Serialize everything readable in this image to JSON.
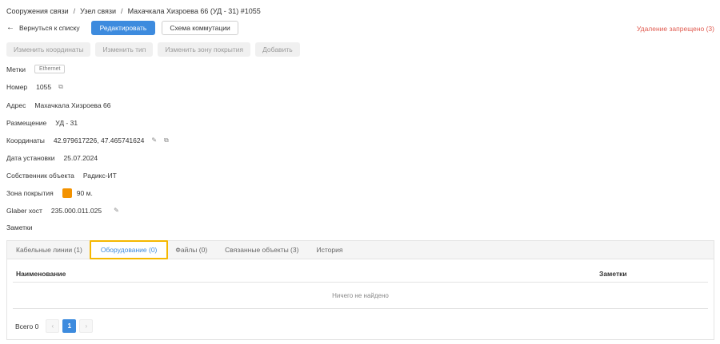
{
  "breadcrumb": [
    "Сооружения связи",
    "Узел связи",
    "Махачкала Хизроева 66 (УД - 31) #1055"
  ],
  "toolbar": {
    "back_label": "Вернуться к списку",
    "edit_label": "Редактировать",
    "scheme_label": "Схема коммутации",
    "delete_note": "Удаление запрещено (3)"
  },
  "actions": [
    "Изменить координаты",
    "Изменить тип",
    "Изменить зону покрытия",
    "Добавить"
  ],
  "fields": {
    "tags_label": "Метки",
    "tag": "Ethernet",
    "number_label": "Номер",
    "number": "1055",
    "address_label": "Адрес",
    "address": "Махачкала Хизроева 66",
    "placement_label": "Размещение",
    "placement": "УД - 31",
    "coords_label": "Координаты",
    "coords": "42.979617226, 47.465741624",
    "install_date_label": "Дата установки",
    "install_date": "25.07.2024",
    "owner_label": "Собственник объекта",
    "owner": "Радикс-ИТ",
    "coverage_label": "Зона покрытия",
    "coverage": "90 м.",
    "coverage_color": "#f39200",
    "glaber_label": "Glaber хост",
    "glaber": "235.000.011.025",
    "notes_label": "Заметки"
  },
  "tabs": [
    "Кабельные линии (1)",
    "Оборудование (0)",
    "Файлы (0)",
    "Связанные объекты (3)",
    "История"
  ],
  "active_tab": "Оборудование (0)",
  "grid": {
    "columns": [
      "Наименование",
      "Заметки"
    ],
    "empty_text": "Ничего не найдено"
  },
  "pager": {
    "total_label": "Всего 0",
    "prev": "‹",
    "current_page": "1",
    "next": "›"
  },
  "colors": {
    "accent": "#3d8bde",
    "warning": "#e05a4f",
    "highlight": "#f5b800"
  },
  "icons": [
    "back-arrow-icon",
    "copy-icon",
    "edit-icon"
  ]
}
